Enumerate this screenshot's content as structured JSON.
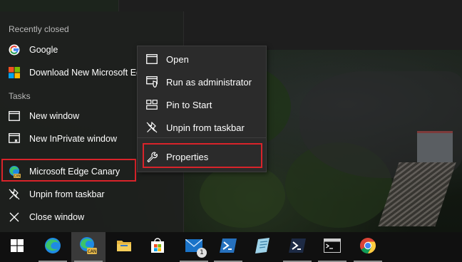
{
  "jump_list": {
    "recent_header": "Recently closed",
    "recent": [
      {
        "label": "Google",
        "icon": "google-icon"
      },
      {
        "label": "Download New Microsoft Edge",
        "icon": "microsoft-icon"
      }
    ],
    "tasks_header": "Tasks",
    "tasks": [
      {
        "label": "New window",
        "icon": "window-icon"
      },
      {
        "label": "New InPrivate window",
        "icon": "inprivate-icon"
      }
    ],
    "app_label": "Microsoft Edge Canary",
    "app_icon_badge": "CAN",
    "unpin_label": "Unpin from taskbar",
    "close_label": "Close window"
  },
  "context_menu": {
    "items": [
      {
        "label": "Open",
        "icon": "window-icon"
      },
      {
        "label": "Run as administrator",
        "icon": "shield-icon"
      },
      {
        "label": "Pin to Start",
        "icon": "pin-start-icon"
      },
      {
        "label": "Unpin from taskbar",
        "icon": "unpin-icon"
      },
      {
        "label": "Properties",
        "icon": "wrench-icon"
      }
    ]
  },
  "taskbar": {
    "icons": [
      "start-icon",
      "edge-icon",
      "edge-canary-icon",
      "file-explorer-icon",
      "store-icon",
      "mail-icon",
      "powershell-icon",
      "notepad-icon",
      "powershell-icon",
      "terminal-icon",
      "chrome-icon"
    ],
    "edge_canary_badge": "CAN",
    "mail_badge": "1"
  },
  "colors": {
    "highlight": "#d9232a",
    "menu_bg": "#2b2b2b",
    "taskbar_bg": "#101010",
    "edge_blue": "#1f8be3",
    "edge_green": "#3bc36b",
    "canary_gold": "#e3b64a"
  }
}
